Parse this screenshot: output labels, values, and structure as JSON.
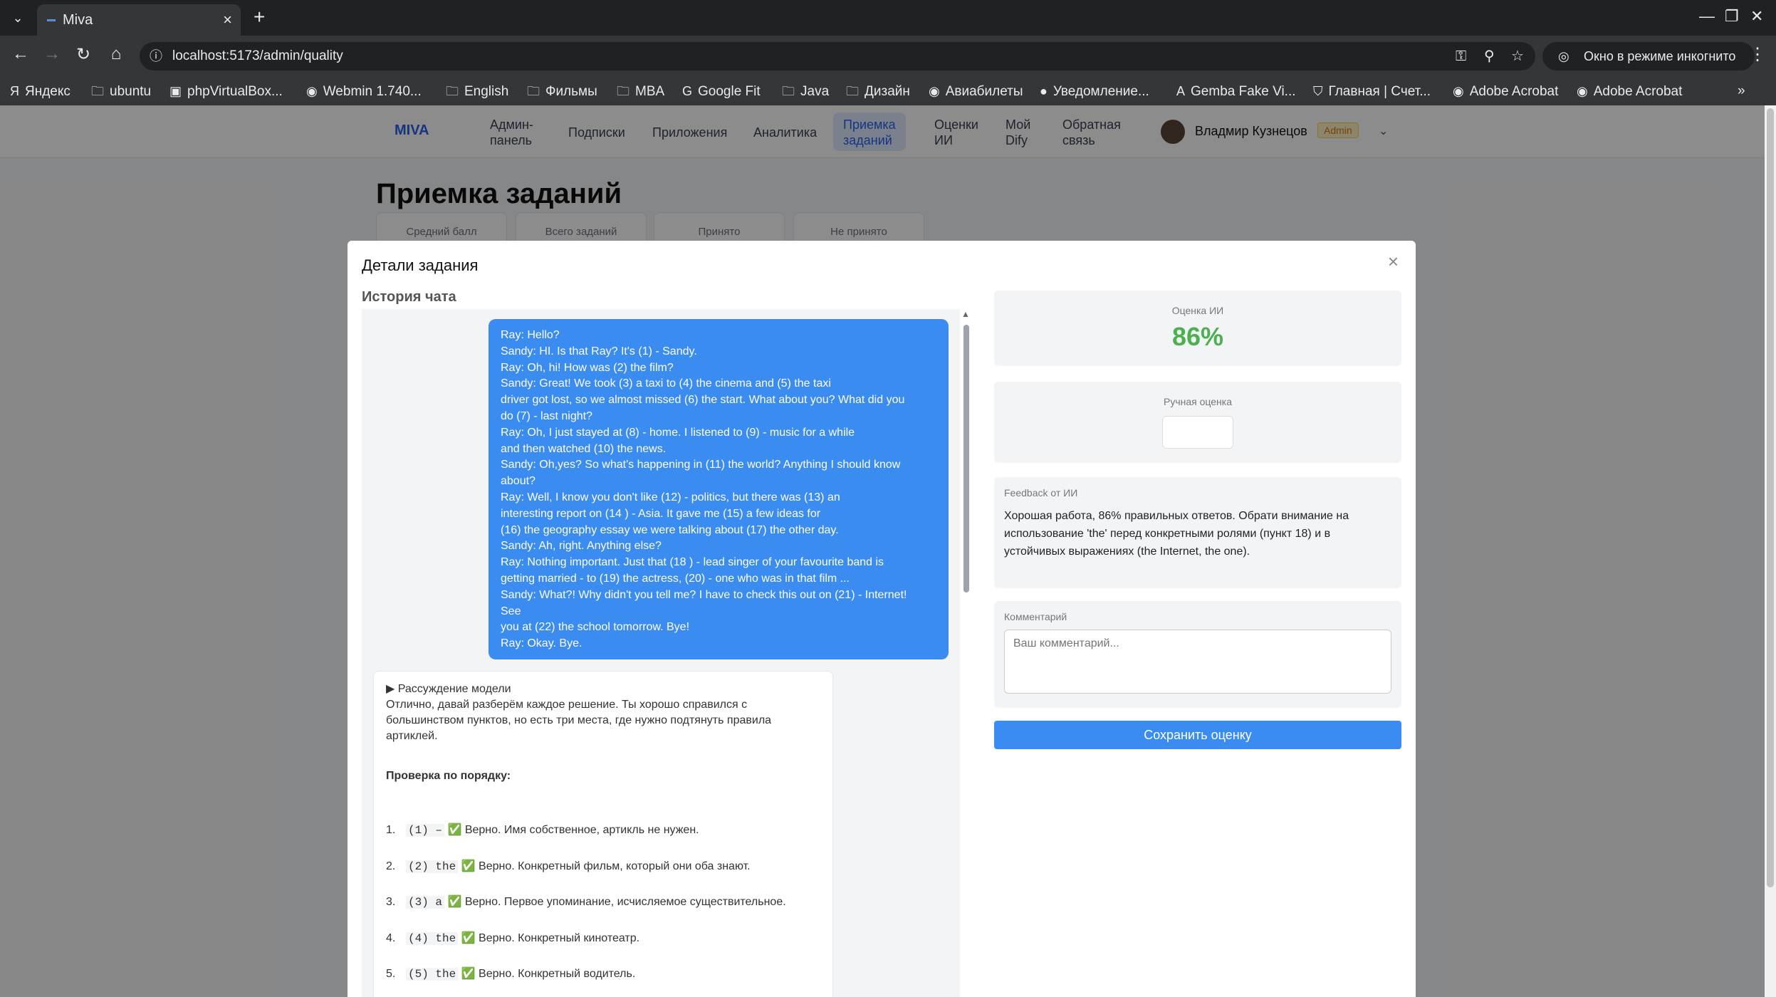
{
  "browser": {
    "tab_title": "Miva",
    "url": "localhost:5173/admin/quality",
    "incognito_label": "Окно в режиме инкогнито",
    "bookmarks": [
      "Яндекс",
      "ubuntu",
      "phpVirtualBox...",
      "Webmin 1.740...",
      "English",
      "Фильмы",
      "MBA",
      "Google Fit",
      "Java",
      "Дизайн",
      "Авиабилеты",
      "Уведомление...",
      "Gemba Fake Vi...",
      "Главная | Счет...",
      "Adobe Acrobat",
      "Adobe Acrobat"
    ]
  },
  "app": {
    "logo": "MIVA",
    "nav": [
      "Админ-\nпанель",
      "Подписки",
      "Приложения",
      "Аналитика",
      "Приемка\nзаданий",
      "Оценки\nИИ",
      "Мой\nDify",
      "Обратная\nсвязь"
    ],
    "user_name": "Владмир Кузнецов",
    "user_role": "Admin",
    "page_title": "Приемка заданий",
    "stat_cards": [
      "Средний балл",
      "Всего заданий",
      "Принято",
      "Не принято"
    ]
  },
  "modal": {
    "title": "Детали задания",
    "close": "×",
    "chat_heading": "История чата",
    "user_message": [
      "Ray: Hello?",
      "Sandy: HI. Is that Ray? It's (1) - Sandy.",
      "Ray: Oh, hi! How was (2) the film?",
      "Sandy: Great! We took (3) a taxi to (4) the cinema and (5) the taxi",
      "driver got lost, so we almost missed (6) the start. What about you? What did you",
      "do (7) - last night?",
      "Ray: Oh, I just stayed at (8) - home. I listened to (9) - music for a while",
      "and then watched (10) the news.",
      "Sandy: Oh,yes? So what's happening in (11) the world? Anything I should know",
      "about?",
      "Ray: Well, I know you don't like (12) - politics, but there was (13) an",
      "interesting report on (14 ) - Asia. It gave me (15) a few ideas for",
      "(16) the geography essay we were talking about (17) the other day.",
      "Sandy: Ah, right. Anything else?",
      "Ray: Nothing important. Just that (18 ) - lead singer of your favourite band is",
      "getting married - to (19) the actress, (20) - one who was in that film ...",
      "Sandy: What?! Why didn't you tell me? I have to check this out on (21) - Internet!",
      "See",
      "you at (22) the school tomorrow. Bye!",
      "Ray: Okay. Bye."
    ],
    "reasoning": {
      "summary": "▶ Рассуждение модели",
      "intro": "Отлично, давай разберём каждое решение. Ты хорошо справился с большинством пунктов, но есть три места, где нужно подтянуть правила артиклей.",
      "check_heading": "Проверка по порядку:",
      "items": [
        {
          "num": "1.",
          "code": "(1) –",
          "text": "✅ Верно. Имя собственное, артикль не нужен."
        },
        {
          "num": "2.",
          "code": "(2) the",
          "text": "✅ Верно. Конкретный фильм, который они оба знают."
        },
        {
          "num": "3.",
          "code": "(3) a",
          "text": "✅ Верно. Первое упоминание, исчисляемое существительное."
        },
        {
          "num": "4.",
          "code": "(4) the",
          "text": "✅ Верно. Конкретный кинотеатр."
        },
        {
          "num": "5.",
          "code": "(5) the",
          "text": "✅ Верно. Конкретный водитель."
        }
      ]
    },
    "ai_score_label": "Оценка ИИ",
    "ai_score": "86%",
    "manual_label": "Ручная оценка",
    "feedback_label": "Feedback от ИИ",
    "feedback_text": "Хорошая работа, 86% правильных ответов. Обрати внимание на использование 'the' перед конкретными ролями (пункт 18) и в устойчивых выражениях (the Internet, the one).",
    "comment_label": "Комментарий",
    "comment_placeholder": "Ваш комментарий...",
    "save_label": "Сохранить оценку"
  },
  "colors": {
    "accent": "#3b8cf0",
    "score_green": "#4caf50",
    "role_badge": "#d97706"
  }
}
